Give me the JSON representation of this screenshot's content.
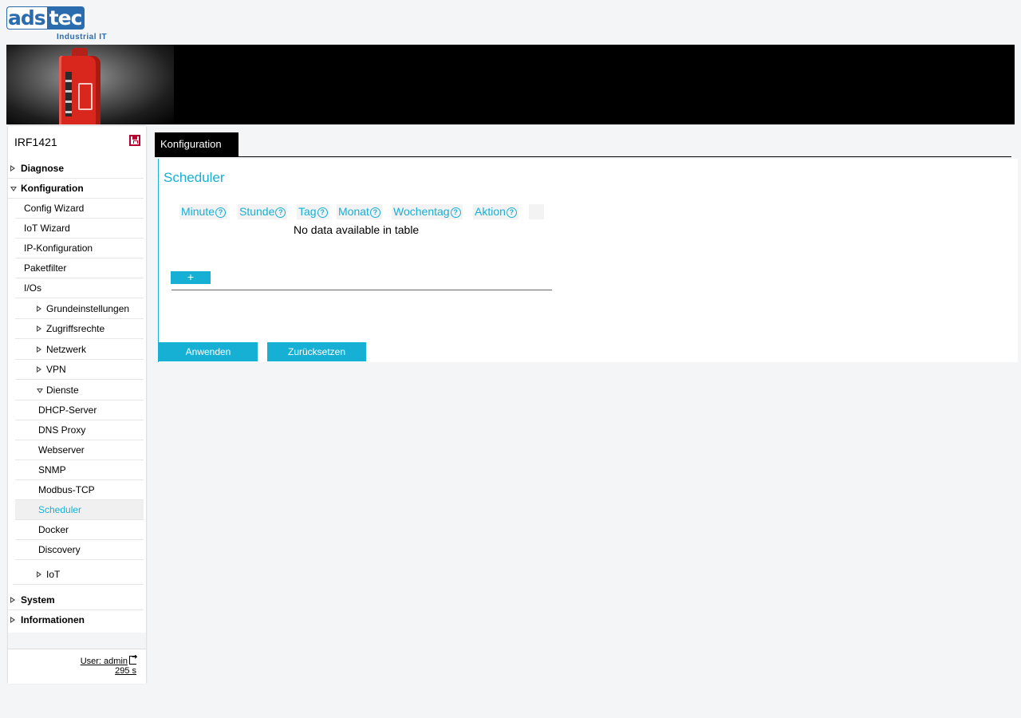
{
  "logo": {
    "part1": "ads",
    "part2": "tec",
    "tagline": "Industrial IT"
  },
  "device": {
    "name": "IRF1421"
  },
  "nav": {
    "diagnose": "Diagnose",
    "konfiguration": "Konfiguration",
    "config_wizard": "Config Wizard",
    "iot_wizard": "IoT Wizard",
    "ip_konfiguration": "IP-Konfiguration",
    "paketfilter": "Paketfilter",
    "ios": "I/Os",
    "grundeinstellungen": "Grundeinstellungen",
    "zugriffsrechte": "Zugriffsrechte",
    "netzwerk": "Netzwerk",
    "vpn": "VPN",
    "dienste": "Dienste",
    "dhcp_server": "DHCP-Server",
    "dns_proxy": "DNS Proxy",
    "webserver": "Webserver",
    "snmp": "SNMP",
    "modbus_tcp": "Modbus-TCP",
    "scheduler": "Scheduler",
    "docker": "Docker",
    "discovery": "Discovery",
    "iot": "IoT",
    "system": "System",
    "informationen": "Informationen"
  },
  "footer": {
    "user": "User: admin",
    "timer": "295 s"
  },
  "tab": {
    "label": "Konfiguration"
  },
  "panel": {
    "title": "Scheduler",
    "columns": [
      "Minute",
      "Stunde",
      "Tag",
      "Monat",
      "Wochentag",
      "Aktion"
    ],
    "help_glyph": "?",
    "empty_message": "No data available in table",
    "add_label": "+",
    "apply_label": "Anwenden",
    "reset_label": "Zurücksetzen"
  },
  "colors": {
    "accent": "#16b0d4",
    "brand": "#2a6cae",
    "active_bg": "#f0f0f0"
  }
}
